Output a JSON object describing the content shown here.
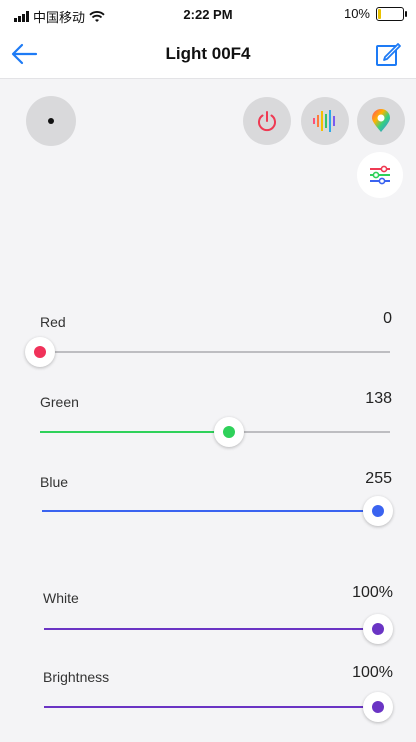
{
  "status": {
    "carrier": "中国移动",
    "time": "2:22 PM",
    "battery": "10%"
  },
  "nav": {
    "title": "Light 00F4"
  },
  "sliders": {
    "red": {
      "label": "Red",
      "value": "0",
      "fraction": 0.0,
      "color": "#f0325a"
    },
    "green": {
      "label": "Green",
      "value": "138",
      "fraction": 0.541,
      "color": "#2fd15a"
    },
    "blue": {
      "label": "Blue",
      "value": "255",
      "fraction": 1.0,
      "color": "#3a63f0"
    },
    "white": {
      "label": "White",
      "value": "100%",
      "fraction": 1.0,
      "color": "#6a34c4"
    },
    "brightness": {
      "label": "Brightness",
      "value": "100%",
      "fraction": 1.0,
      "color": "#6a34c4"
    }
  },
  "icons": {
    "back": "back-arrow-icon",
    "edit": "edit-icon",
    "more": "more-icon",
    "power": "power-icon",
    "music": "music-icon",
    "color": "color-palette-icon",
    "adjust": "adjust-icon"
  }
}
